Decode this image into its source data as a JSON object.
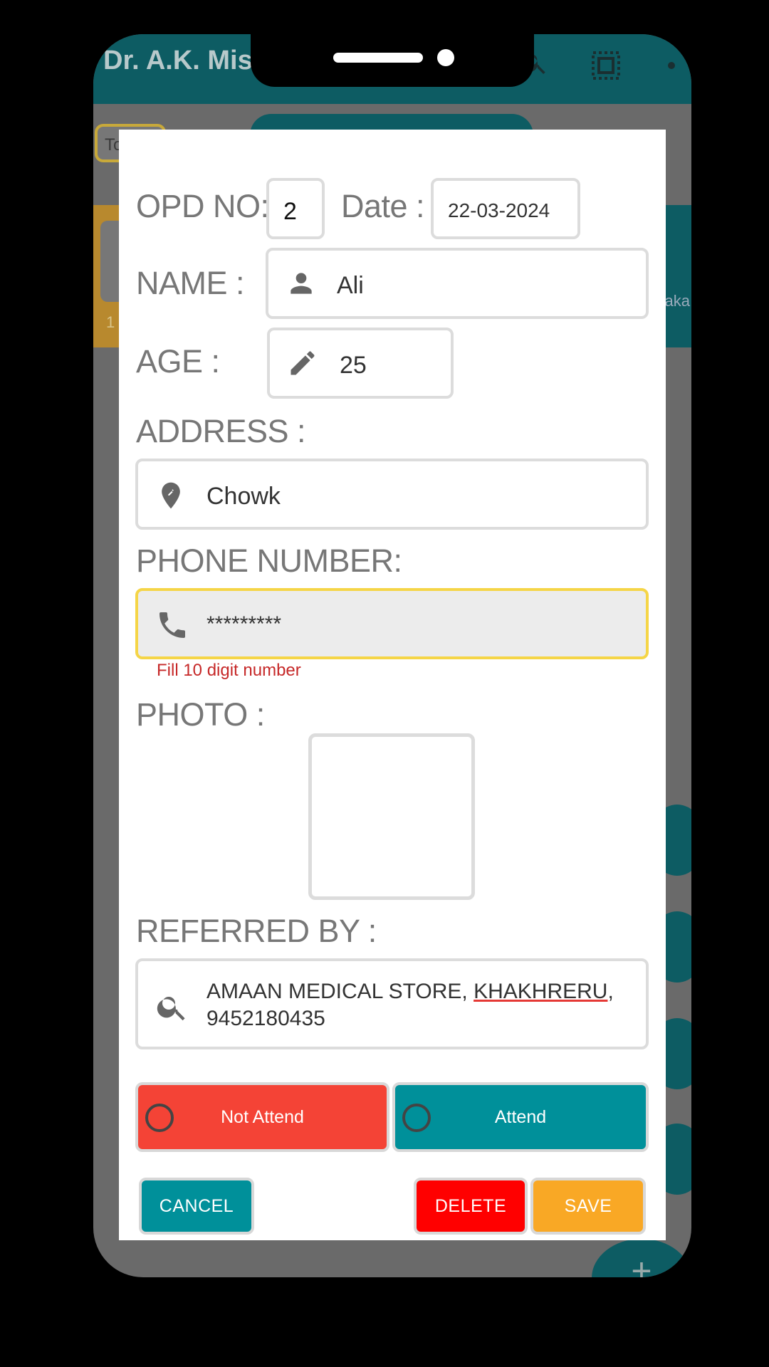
{
  "app": {
    "title": "Dr. A.K. Mish",
    "today_label": "To",
    "right_snippet": "aka",
    "left_num": "1",
    "fab_plus": "+"
  },
  "form": {
    "opd_label": "OPD NO:",
    "opd_value": "2",
    "date_label": "Date :",
    "date_value": "22-03-2024",
    "name_label": "NAME :",
    "name_value": "Ali",
    "age_label": "AGE :",
    "age_value": "25",
    "address_label": "ADDRESS :",
    "address_value": "Chowk",
    "phone_label": "PHONE NUMBER:",
    "phone_value": "*********",
    "phone_error": "Fill 10 digit number",
    "photo_label": "PHOTO :",
    "referred_label": "REFERRED BY :",
    "referred_line1_a": "AMAAN MEDICAL STORE, ",
    "referred_line1_b": "KHAKHRERU",
    "referred_line1_c": ",",
    "referred_line2": "9452180435"
  },
  "status": {
    "not_attend": "Not Attend",
    "attend": "Attend"
  },
  "actions": {
    "cancel": "CANCEL",
    "delete": "DELETE",
    "save": "SAVE"
  },
  "colors": {
    "teal": "#00909a",
    "red_status": "#f44336",
    "delete": "#ff0000",
    "save": "#f9a825",
    "error": "#c62828",
    "focus": "#f5d547"
  }
}
